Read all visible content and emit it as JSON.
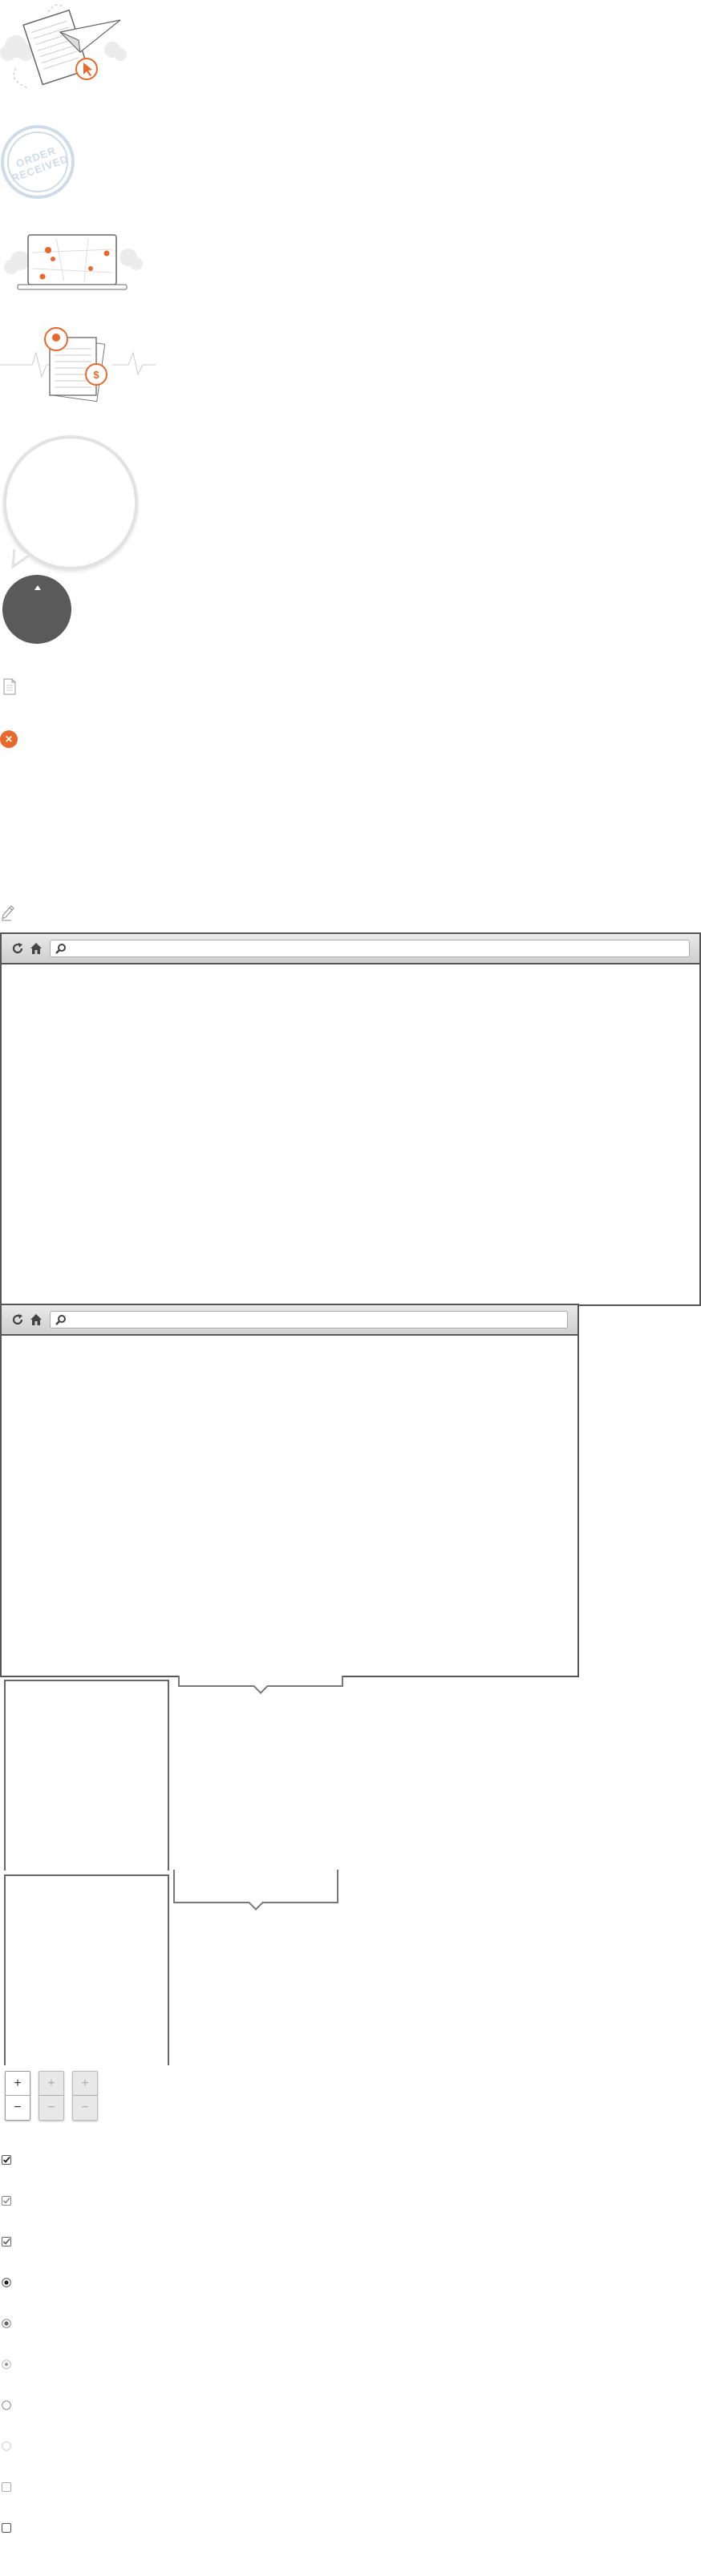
{
  "illustrations": {
    "stamp": {
      "line1": "ORDER",
      "line2": "RECEIVED"
    },
    "price_badge": "$"
  },
  "close_badge": "✕",
  "browser_large": {
    "search_placeholder": ""
  },
  "browser_small": {
    "search_placeholder": ""
  },
  "steppers": [
    {
      "plus": "+",
      "minus": "−",
      "state": "enabled"
    },
    {
      "plus": "+",
      "minus": "−",
      "state": "disabled"
    },
    {
      "plus": "+",
      "minus": "−",
      "state": "disabled"
    }
  ],
  "checkbox_states": [
    "checked",
    "checked-hover",
    "checked-focus",
    "radio-selected",
    "radio-selected-hover",
    "radio-selected-disabled",
    "radio-empty",
    "radio-empty-disabled",
    "checkbox-empty-disabled",
    "checkbox-empty"
  ],
  "colors": {
    "accent": "#e8692c",
    "dark": "#5a5a5a",
    "stamp": "#cfdbe8",
    "border": "#555555"
  }
}
